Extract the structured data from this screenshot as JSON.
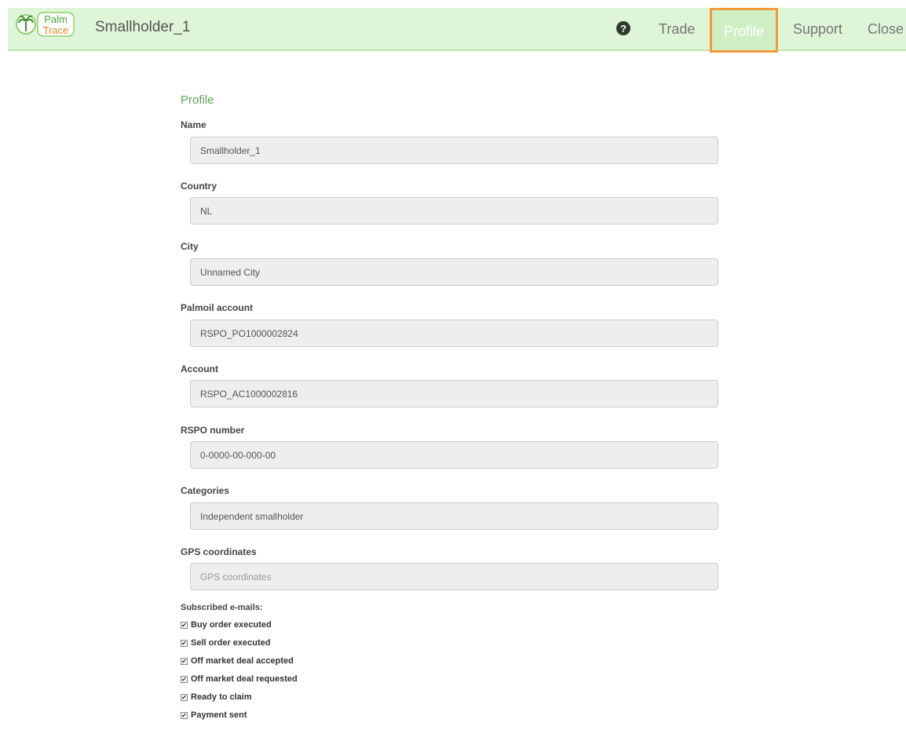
{
  "navbar": {
    "logo_text_top": "Palm",
    "logo_text_bottom": "Trace",
    "brand": "Smallholder_1",
    "help_icon": "question-circle-icon",
    "links": [
      {
        "label": "Trade",
        "active": false
      },
      {
        "label": "Profile",
        "active": true
      },
      {
        "label": "Support",
        "active": false
      },
      {
        "label": "Close",
        "active": false
      }
    ],
    "accent_color": "#f29b38",
    "bar_color": "#dff5d8"
  },
  "profile": {
    "title": "Profile",
    "fields": [
      {
        "label": "Name",
        "value": "Smallholder_1",
        "placeholder": ""
      },
      {
        "label": "Country",
        "value": "NL",
        "placeholder": ""
      },
      {
        "label": "City",
        "value": "Unnamed City",
        "placeholder": ""
      },
      {
        "label": "Palmoil account",
        "value": "RSPO_PO1000002824",
        "placeholder": ""
      },
      {
        "label": "Account",
        "value": "RSPO_AC1000002816",
        "placeholder": ""
      },
      {
        "label": "RSPO number",
        "value": "0-0000-00-000-00",
        "placeholder": ""
      },
      {
        "label": "Categories",
        "value": "Independent smallholder",
        "placeholder": ""
      },
      {
        "label": "GPS coordinates",
        "value": "",
        "placeholder": "GPS coordinates"
      }
    ],
    "subscribed_label": "Subscribed e-mails:",
    "subscriptions": [
      {
        "label": "Buy order executed",
        "checked": true
      },
      {
        "label": "Sell order executed",
        "checked": true
      },
      {
        "label": "Off market deal accepted",
        "checked": true
      },
      {
        "label": "Off market deal requested",
        "checked": true
      },
      {
        "label": "Ready to claim",
        "checked": true
      },
      {
        "label": "Payment sent",
        "checked": true
      }
    ]
  }
}
